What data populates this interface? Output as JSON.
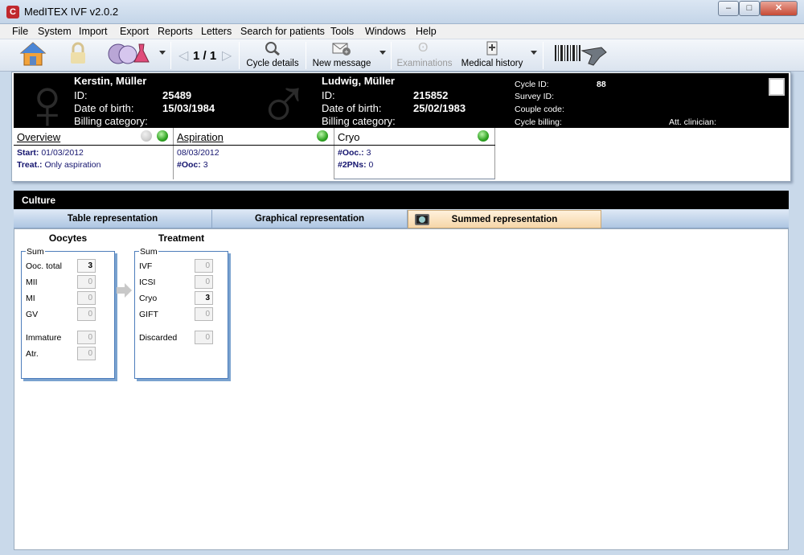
{
  "window": {
    "title": "MedITEX IVF v2.0.2",
    "app_icon": "meditex-logo-icon",
    "minimize": "minimize-button",
    "maximize": "maximize-button",
    "close": "close-button"
  },
  "menu": [
    "File",
    "System",
    "Import",
    "Export",
    "Reports",
    "Letters",
    "Search for patients",
    "Tools",
    "Windows",
    "Help"
  ],
  "toolbar": {
    "home_icon": "home-icon",
    "lock_icon": "lock-icon",
    "patients_icon": "couple-flask-icon",
    "record_counter": "1 / 1",
    "cycle_details": "Cycle details",
    "new_message": "New message",
    "examinations": "Examinations",
    "medical_history": "Medical history",
    "barcode_icon": "barcode-scanner-icon"
  },
  "female": {
    "name": "Kerstin, Müller",
    "id_label": "ID:",
    "id": "25489",
    "dob_label": "Date of birth:",
    "dob": "15/03/1984",
    "billing_label": "Billing category:"
  },
  "male": {
    "name": "Ludwig, Müller",
    "id_label": "ID:",
    "id": "215852",
    "dob_label": "Date of birth:",
    "dob": "25/02/1983",
    "billing_label": "Billing category:"
  },
  "cycle_info": {
    "cycle_id_label": "Cycle ID:",
    "cycle_id": "88",
    "survey_id_label": "Survey ID:",
    "couple_code_label": "Couple code:",
    "cycle_billing_label": "Cycle billing:",
    "clinician_label": "Att. clinician:"
  },
  "cards": {
    "overview": {
      "title": "Overview",
      "start_label": "Start:",
      "start": "01/03/2012",
      "treat_label": "Treat.:",
      "treat": "Only aspiration"
    },
    "aspiration": {
      "title": "Aspiration",
      "date": "08/03/2012",
      "ooc_label": "#Ooc:",
      "ooc": "3"
    },
    "cryo": {
      "title": "Cryo",
      "ooc_label": "#Ooc.:",
      "ooc": "3",
      "pn_label": "#2PNs:",
      "pn": "0"
    }
  },
  "status_colors": {
    "green": "#2fa322",
    "gray": "#cfcfcf"
  },
  "culture": {
    "title": "Culture",
    "tabs": [
      "Table representation",
      "Graphical representation",
      "Summed representation"
    ],
    "active_tab": "Summed representation",
    "oocytes": {
      "title": "Oocytes",
      "legend": "Sum",
      "rows": [
        {
          "label": "Ooc. total",
          "value": "3"
        },
        {
          "label": "MII",
          "value": "0"
        },
        {
          "label": "MI",
          "value": "0"
        },
        {
          "label": "GV",
          "value": "0"
        },
        {
          "label": "Immature",
          "value": "0"
        },
        {
          "label": "Atr.",
          "value": "0"
        }
      ]
    },
    "treatment": {
      "title": "Treatment",
      "legend": "Sum",
      "rows": [
        {
          "label": "IVF",
          "value": "0"
        },
        {
          "label": "ICSI",
          "value": "0"
        },
        {
          "label": "Cryo",
          "value": "3"
        },
        {
          "label": "GIFT",
          "value": "0"
        },
        {
          "label": "Discarded",
          "value": "0"
        }
      ]
    }
  }
}
